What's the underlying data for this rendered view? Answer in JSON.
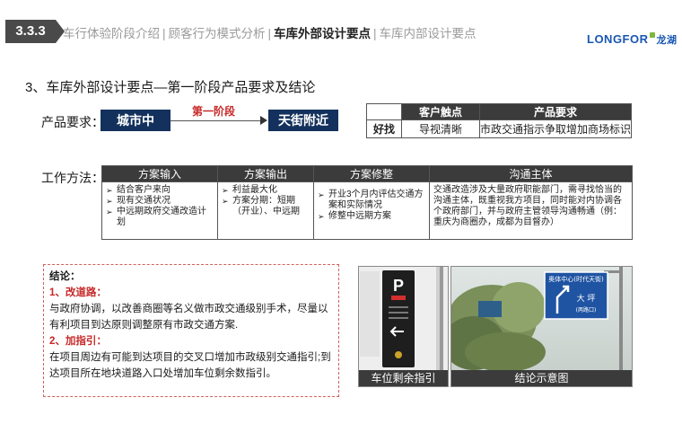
{
  "header": {
    "section_number": "3.3.3",
    "crumbs": [
      {
        "label": "车行体验阶段介绍",
        "current": false
      },
      {
        "label": "顾客行为模式分析",
        "current": false
      },
      {
        "label": "车库外部设计要点",
        "current": true
      },
      {
        "label": "车库内部设计要点",
        "current": false
      }
    ],
    "separator": "|",
    "logo_text": "LONGFOR",
    "logo_cn": "龙湖"
  },
  "title": "3、车库外部设计要点—第一阶段产品要求及结论",
  "product_req": {
    "label": "产品要求：",
    "from": "城市中",
    "phase": "第一阶段",
    "to": "天街附近",
    "table": {
      "headers": [
        "",
        "客户触点",
        "产品要求"
      ],
      "row": [
        "好找",
        "导视清晰",
        "市政交通指示争取增加商场标识"
      ]
    }
  },
  "work_method": {
    "label": "工作方法：",
    "headers": [
      "方案输入",
      "方案输出",
      "方案修整",
      "沟通主体"
    ],
    "inputs": [
      "结合客户来向",
      "现有交通状况",
      "中远期政府交通改造计划"
    ],
    "outputs": [
      "利益最大化",
      "方案分期：短期（开业）、中远期"
    ],
    "revisions": [
      "开业3个月内评估交通方案和实际情况",
      "修整中远期方案"
    ],
    "communication": "交通改造涉及大量政府职能部门，需寻找恰当的沟通主体，既重视我方项目，同时能对内协调各个政府部门，并与政府主管领导沟通畅通（例：重庆为商圈办，成都为目督办）"
  },
  "conclusion": {
    "heading": "结论：",
    "item1_title": "1、改道路：",
    "item1_text": "与政府协调，以改善商圈等名义做市政交通级别手术，尽量以有利项目到达原则调整原有市政交通方案.",
    "item2_title": "2、加指引：",
    "item2_text": "在项目周边有可能到达项目的交叉口增加市政级别交通指引;到达项目所在地块道路入口处增加车位剩余数指引。"
  },
  "images": {
    "left_caption": "车位剩余指引",
    "right_caption": "结论示意图",
    "sign_p": "P",
    "sign_right_line1": "奥体中心(时代天街)",
    "sign_right_line2": "大 坪",
    "sign_right_line3": "(两路口)"
  },
  "colors": {
    "navy": "#13315c",
    "header_dark": "#3b3b3b",
    "accent_red": "#c62828",
    "logo_blue": "#1a57b3"
  }
}
